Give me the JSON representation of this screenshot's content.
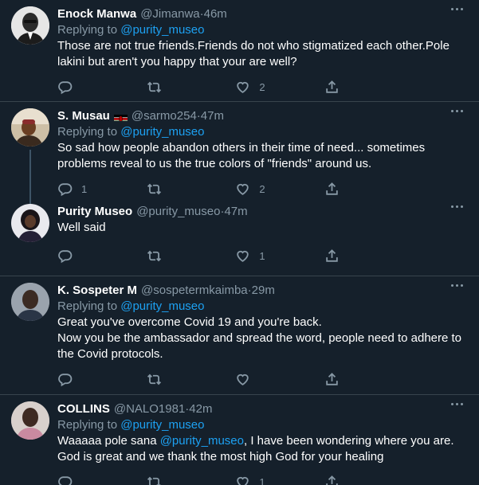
{
  "tweets": [
    {
      "name": "Enock Manwa",
      "handle": "@Jimanwa",
      "time": "46m",
      "replying_prefix": "Replying to",
      "replying_to": "@purity_museo",
      "text": "Those are not true friends.Friends do not who stigmatized each other.Pole lakini but aren't you happy that your are well?",
      "replies": "",
      "retweets": "",
      "likes": "2"
    },
    {
      "name": "S. Musau",
      "flag": "kenya-flag",
      "handle": "@sarmo254",
      "time": "47m",
      "replying_prefix": "Replying to",
      "replying_to": "@purity_museo",
      "text": "So sad how people abandon others in their time of need... sometimes problems reveal to us the true colors of \"friends\" around us.",
      "replies": "1",
      "retweets": "",
      "likes": "2"
    },
    {
      "name": "Purity Museo",
      "handle": "@purity_museo",
      "time": "47m",
      "text": "Well said",
      "replies": "",
      "retweets": "",
      "likes": "1"
    },
    {
      "name": "K. Sospeter M",
      "handle": "@sospetermkaimba",
      "time": "29m",
      "replying_prefix": "Replying to",
      "replying_to": "@purity_museo",
      "text_lines": [
        "Great you've overcome Covid 19 and you're back.",
        "Now you be the ambassador and spread the word, people need to adhere to the Covid protocols."
      ],
      "replies": "",
      "retweets": "",
      "likes": ""
    },
    {
      "name": "COLLINS",
      "handle": "@NALO1981",
      "time": "42m",
      "replying_prefix": "Replying to",
      "replying_to": "@purity_museo",
      "text_before": "Waaaaa pole sana ",
      "text_mention": "@purity_museo",
      "text_after": ", I have been wondering where you are. God is great and we thank the most high God for your healing",
      "replies": "",
      "retweets": "",
      "likes": "1"
    }
  ],
  "separator": " · ",
  "colors": {
    "background": "#15202b",
    "border": "#38444d",
    "secondary_text": "#8899a6",
    "link": "#1da1f2",
    "thread_line": "#3d5466"
  },
  "icons": {
    "reply": "reply-icon",
    "retweet": "retweet-icon",
    "like": "heart-icon",
    "share": "share-icon",
    "more": "more-icon"
  }
}
